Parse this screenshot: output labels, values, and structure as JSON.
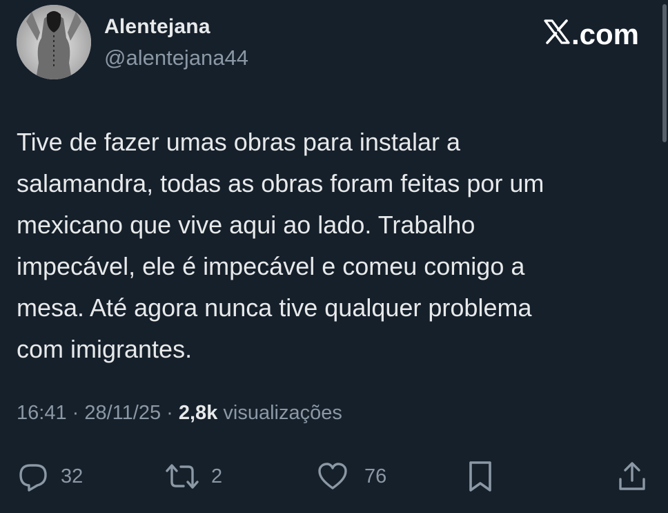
{
  "author": {
    "display_name": "Alentejana",
    "handle": "@alentejana44"
  },
  "brand": {
    "label": ".com",
    "icon": "x-logo-icon"
  },
  "tweet": {
    "lines": [
      "Tive de fazer umas obras para instalar a",
      "salamandra, todas as obras foram feitas por um",
      "mexicano que vive aqui ao lado. Trabalho",
      "impecável, ele é impecável e comeu comigo a",
      "mesa. Até agora nunca tive qualquer problema",
      "com imigrantes."
    ]
  },
  "meta": {
    "time": "16:41",
    "separator": " · ",
    "date": "28/11/25",
    "views_count": "2,8k",
    "views_label": " visualizações"
  },
  "actions": {
    "reply": {
      "icon": "reply-icon",
      "count": "32"
    },
    "repost": {
      "icon": "repost-icon",
      "count": "2"
    },
    "like": {
      "icon": "heart-icon",
      "count": "76"
    },
    "bookmark": {
      "icon": "bookmark-icon"
    },
    "share": {
      "icon": "share-icon"
    }
  },
  "colors": {
    "background": "#16202b",
    "primary_text": "#e7e9ea",
    "secondary_text": "#8b98a5"
  }
}
